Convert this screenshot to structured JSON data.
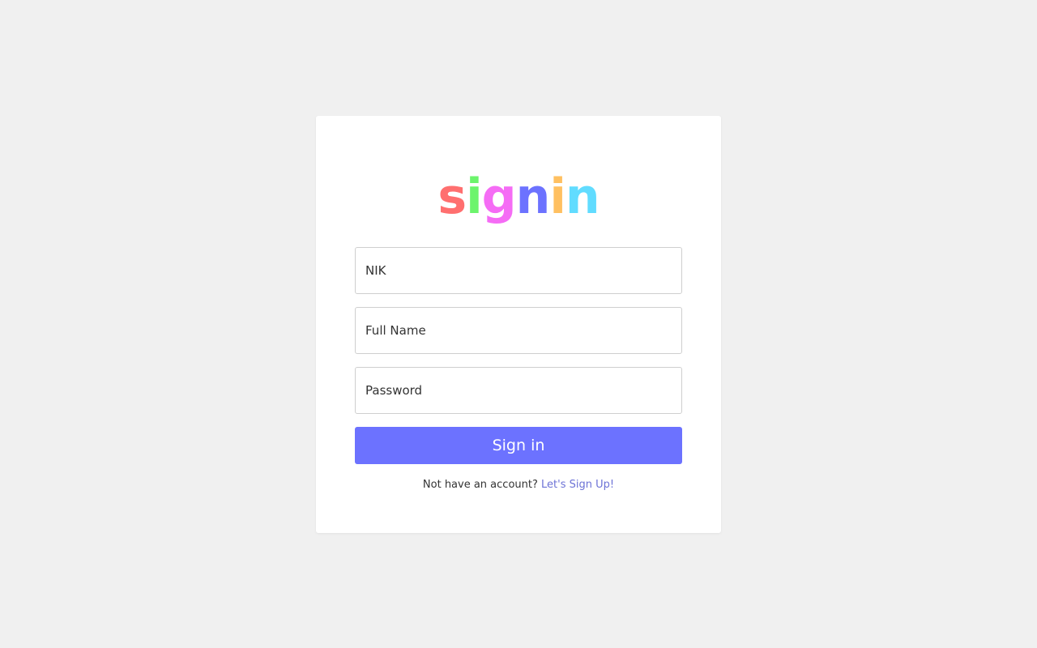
{
  "colors": {
    "background": "#f0f0f0",
    "card": "#ffffff",
    "accent": "#6c72ff",
    "link": "#6c72d6"
  },
  "logo": {
    "letters": [
      {
        "char": "s",
        "color": "#ff6f6f"
      },
      {
        "char": "i",
        "color": "#6cf46c"
      },
      {
        "char": "g",
        "color": "#f56cf5"
      },
      {
        "char": "n",
        "color": "#6c72ff"
      },
      {
        "char": "i",
        "color": "#ffc061"
      },
      {
        "char": "n",
        "color": "#61dcff"
      }
    ]
  },
  "form": {
    "nik": {
      "placeholder": "NIK",
      "value": ""
    },
    "full_name": {
      "placeholder": "Full Name",
      "value": ""
    },
    "password": {
      "placeholder": "Password",
      "value": ""
    },
    "submit_label": "Sign in"
  },
  "footer": {
    "prompt": "Not have an account?",
    "link_label": "Let's Sign Up!"
  }
}
